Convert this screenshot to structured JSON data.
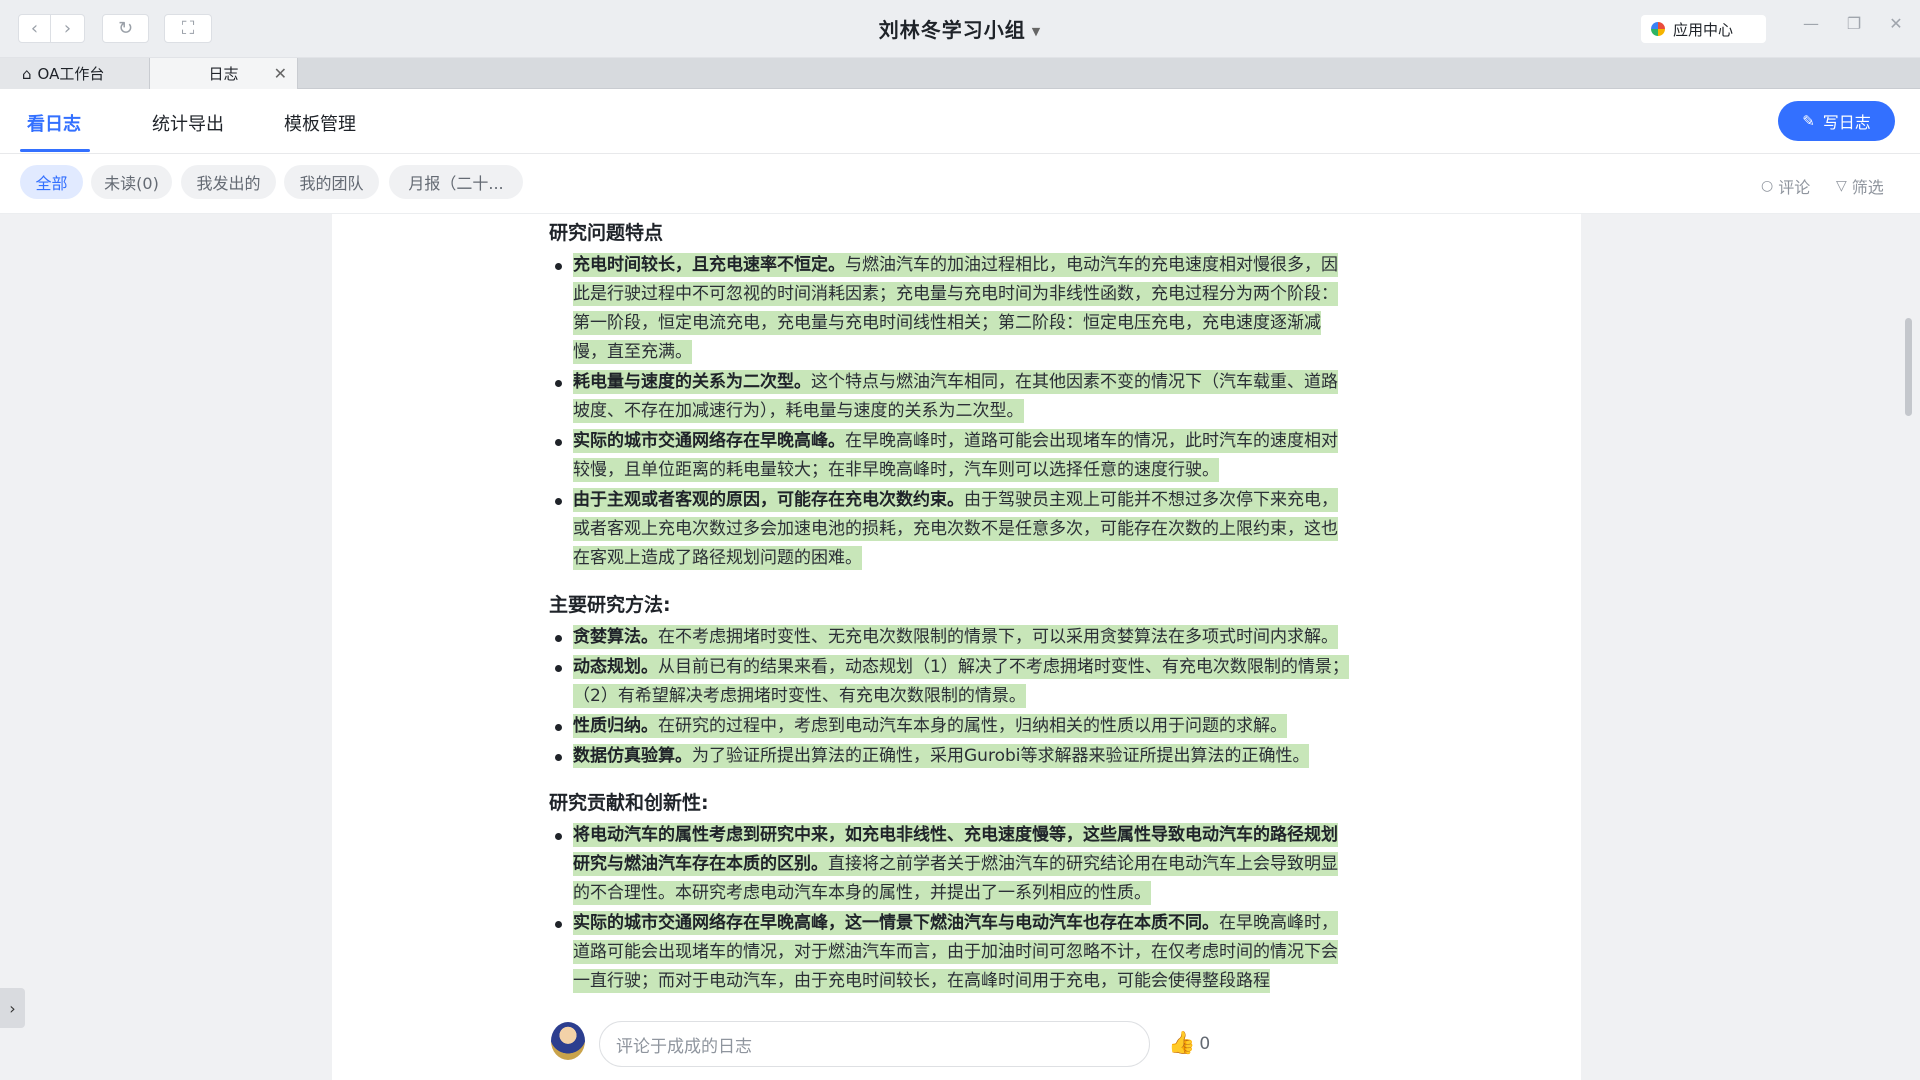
{
  "window": {
    "title": "刘林冬学习小组",
    "app_center": "应用中心",
    "controls": {
      "minimize": "—",
      "restore": "❐",
      "close": "✕"
    }
  },
  "tabs": [
    {
      "label": "OA工作台",
      "icon": "home-icon"
    },
    {
      "label": "日志",
      "close": "✕"
    }
  ],
  "nav": {
    "tabs": [
      "看日志",
      "统计导出",
      "模板管理"
    ],
    "active": "看日志",
    "write_button": "写日志",
    "accent": "#3370ff"
  },
  "filters": {
    "chips": [
      "全部",
      "未读(0)",
      "我发出的",
      "我的团队",
      "月报（二十..."
    ],
    "active": "全部",
    "comment": "评论",
    "filter": "筛选"
  },
  "doc": {
    "highlight_color": "#c8e6b9",
    "sections": [
      {
        "heading": "研究问题特点",
        "items": [
          {
            "bold": "充电时间较长，且充电速率不恒定。",
            "text": "与燃油汽车的加油过程相比，电动汽车的充电速度相对慢很多，因此是行驶过程中不可忽视的时间消耗因素；充电量与充电时间为非线性函数，充电过程分为两个阶段：第一阶段，恒定电流充电，充电量与充电时间线性相关；第二阶段：恒定电压充电，充电速度逐渐减慢，直至充满。"
          },
          {
            "bold": "耗电量与速度的关系为二次型。",
            "text": "这个特点与燃油汽车相同，在其他因素不变的情况下（汽车载重、道路坡度、不存在加减速行为），耗电量与速度的关系为二次型。"
          },
          {
            "bold": "实际的城市交通网络存在早晚高峰。",
            "text": "在早晚高峰时，道路可能会出现堵车的情况，此时汽车的速度相对较慢，且单位距离的耗电量较大；在非早晚高峰时，汽车则可以选择任意的速度行驶。"
          },
          {
            "bold": "由于主观或者客观的原因，可能存在充电次数约束。",
            "text": "由于驾驶员主观上可能并不想过多次停下来充电，或者客观上充电次数过多会加速电池的损耗，充电次数不是任意多次，可能存在次数的上限约束，这也在客观上造成了路径规划问题的困难。"
          }
        ]
      },
      {
        "heading": "主要研究方法:",
        "items": [
          {
            "bold": "贪婪算法。",
            "text": "在不考虑拥堵时变性、无充电次数限制的情景下，可以采用贪婪算法在多项式时间内求解。"
          },
          {
            "bold": "动态规划。",
            "text": "从目前已有的结果来看，动态规划（1）解决了不考虑拥堵时变性、有充电次数限制的情景；（2）有希望解决考虑拥堵时变性、有充电次数限制的情景。"
          },
          {
            "bold": "性质归纳。",
            "text": "在研究的过程中，考虑到电动汽车本身的属性，归纳相关的性质以用于问题的求解。"
          },
          {
            "bold": "数据仿真验算。",
            "text": "为了验证所提出算法的正确性，采用Gurobi等求解器来验证所提出算法的正确性。"
          }
        ]
      },
      {
        "heading": "研究贡献和创新性:",
        "items": [
          {
            "bold": "将电动汽车的属性考虑到研究中来，如充电非线性、充电速度慢等，这些属性导致电动汽车的路径规划研究与燃油汽车存在本质的区别。",
            "text": "直接将之前学者关于燃油汽车的研究结论用在电动汽车上会导致明显的不合理性。本研究考虑电动汽车本身的属性，并提出了一系列相应的性质。"
          },
          {
            "bold": "实际的城市交通网络存在早晚高峰，这一情景下燃油汽车与电动汽车也存在本质不同。",
            "text": "在早晚高峰时，道路可能会出现堵车的情况，对于燃油汽车而言，由于加油时间可忽略不计，在仅考虑时间的情况下会一直行驶；而对于电动汽车，由于充电时间较长，在高峰时间用于充电，可能会使得整段路程"
          }
        ]
      }
    ]
  },
  "comment_bar": {
    "placeholder": "评论于成成的日志",
    "likes": "0"
  }
}
